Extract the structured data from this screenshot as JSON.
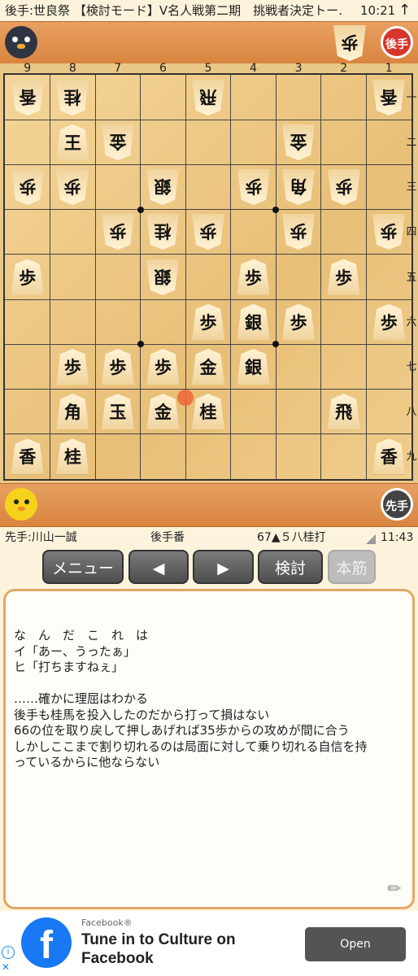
{
  "header": {
    "title": "後手:世良祭 【検討モード】V名人戦第二期　挑戦者決定トー…",
    "time": "10:21"
  },
  "gote": {
    "badge": "後手",
    "hand_piece": "歩"
  },
  "sente": {
    "badge": "先手"
  },
  "board": {
    "col_labels": [
      "9",
      "8",
      "7",
      "6",
      "5",
      "4",
      "3",
      "2",
      "1"
    ],
    "row_labels": [
      "一",
      "二",
      "三",
      "四",
      "五",
      "六",
      "七",
      "八",
      "九"
    ],
    "pieces": [
      {
        "col": 9,
        "row": 1,
        "char": "香",
        "owner": "gote"
      },
      {
        "col": 8,
        "row": 1,
        "char": "桂",
        "owner": "gote"
      },
      {
        "col": 5,
        "row": 1,
        "char": "飛",
        "owner": "gote"
      },
      {
        "col": 1,
        "row": 1,
        "char": "香",
        "owner": "gote"
      },
      {
        "col": 8,
        "row": 2,
        "char": "王",
        "owner": "sente"
      },
      {
        "col": 7,
        "row": 2,
        "char": "金",
        "owner": "gote"
      },
      {
        "col": 3,
        "row": 2,
        "char": "金",
        "owner": "gote"
      },
      {
        "col": 9,
        "row": 3,
        "char": "歩",
        "owner": "gote"
      },
      {
        "col": 8,
        "row": 3,
        "char": "歩",
        "owner": "gote"
      },
      {
        "col": 6,
        "row": 3,
        "char": "銀",
        "owner": "gote"
      },
      {
        "col": 4,
        "row": 3,
        "char": "歩",
        "owner": "gote"
      },
      {
        "col": 3,
        "row": 3,
        "char": "角",
        "owner": "gote"
      },
      {
        "col": 2,
        "row": 3,
        "char": "歩",
        "owner": "gote"
      },
      {
        "col": 7,
        "row": 4,
        "char": "歩",
        "owner": "gote"
      },
      {
        "col": 6,
        "row": 4,
        "char": "桂",
        "owner": "gote"
      },
      {
        "col": 5,
        "row": 4,
        "char": "歩",
        "owner": "gote"
      },
      {
        "col": 3,
        "row": 4,
        "char": "歩",
        "owner": "gote"
      },
      {
        "col": 1,
        "row": 4,
        "char": "歩",
        "owner": "gote"
      },
      {
        "col": 9,
        "row": 5,
        "char": "歩",
        "owner": "sente"
      },
      {
        "col": 6,
        "row": 5,
        "char": "銀",
        "owner": "gote"
      },
      {
        "col": 4,
        "row": 5,
        "char": "歩",
        "owner": "sente"
      },
      {
        "col": 2,
        "row": 5,
        "char": "歩",
        "owner": "sente"
      },
      {
        "col": 5,
        "row": 6,
        "char": "歩",
        "owner": "sente"
      },
      {
        "col": 4,
        "row": 6,
        "char": "銀",
        "owner": "sente"
      },
      {
        "col": 3,
        "row": 6,
        "char": "歩",
        "owner": "sente"
      },
      {
        "col": 1,
        "row": 6,
        "char": "歩",
        "owner": "sente"
      },
      {
        "col": 8,
        "row": 7,
        "char": "歩",
        "owner": "sente"
      },
      {
        "col": 7,
        "row": 7,
        "char": "歩",
        "owner": "sente"
      },
      {
        "col": 6,
        "row": 7,
        "char": "歩",
        "owner": "sente"
      },
      {
        "col": 5,
        "row": 7,
        "char": "金",
        "owner": "sente"
      },
      {
        "col": 4,
        "row": 7,
        "char": "銀",
        "owner": "sente"
      },
      {
        "col": 8,
        "row": 8,
        "char": "角",
        "owner": "sente"
      },
      {
        "col": 7,
        "row": 8,
        "char": "玉",
        "owner": "sente"
      },
      {
        "col": 6,
        "row": 8,
        "char": "金",
        "owner": "sente"
      },
      {
        "col": 5,
        "row": 8,
        "char": "桂",
        "owner": "sente"
      },
      {
        "col": 2,
        "row": 8,
        "char": "飛",
        "owner": "sente"
      },
      {
        "col": 9,
        "row": 9,
        "char": "香",
        "owner": "sente"
      },
      {
        "col": 8,
        "row": 9,
        "char": "桂",
        "owner": "sente"
      },
      {
        "col": 1,
        "row": 9,
        "char": "香",
        "owner": "sente"
      }
    ],
    "last_move": {
      "col": 5,
      "row": 8
    },
    "colors": {
      "last_move_marker": "#f06a3a"
    }
  },
  "status": {
    "sente_name": "先手:川山一誠",
    "turn": "後手番",
    "move": "67▲５八桂打",
    "time": "11:43"
  },
  "buttons": {
    "menu": "メニュー",
    "prev": "◀",
    "next": "▶",
    "analyze": "検討",
    "mainline": "本筋"
  },
  "comment": {
    "lines": [
      "な　ん　だ　こ　れ　は",
      "イ「あー、うったぁ」",
      "ヒ「打ちますねぇ」",
      "",
      "……確かに理屈はわかる",
      "後手も桂馬を投入したのだから打って損はない",
      "66の位を取り戻して押しあげれば35歩からの攻めが間に合う",
      "しかしここまで割り切れるのは局面に対して乗り切れる自信を持",
      "っているからに他ならない"
    ]
  },
  "ad": {
    "source": "Facebook®",
    "headline": "Tune in to Culture on Facebook",
    "button": "Open",
    "colors": {
      "brand": "#1877f2"
    }
  }
}
